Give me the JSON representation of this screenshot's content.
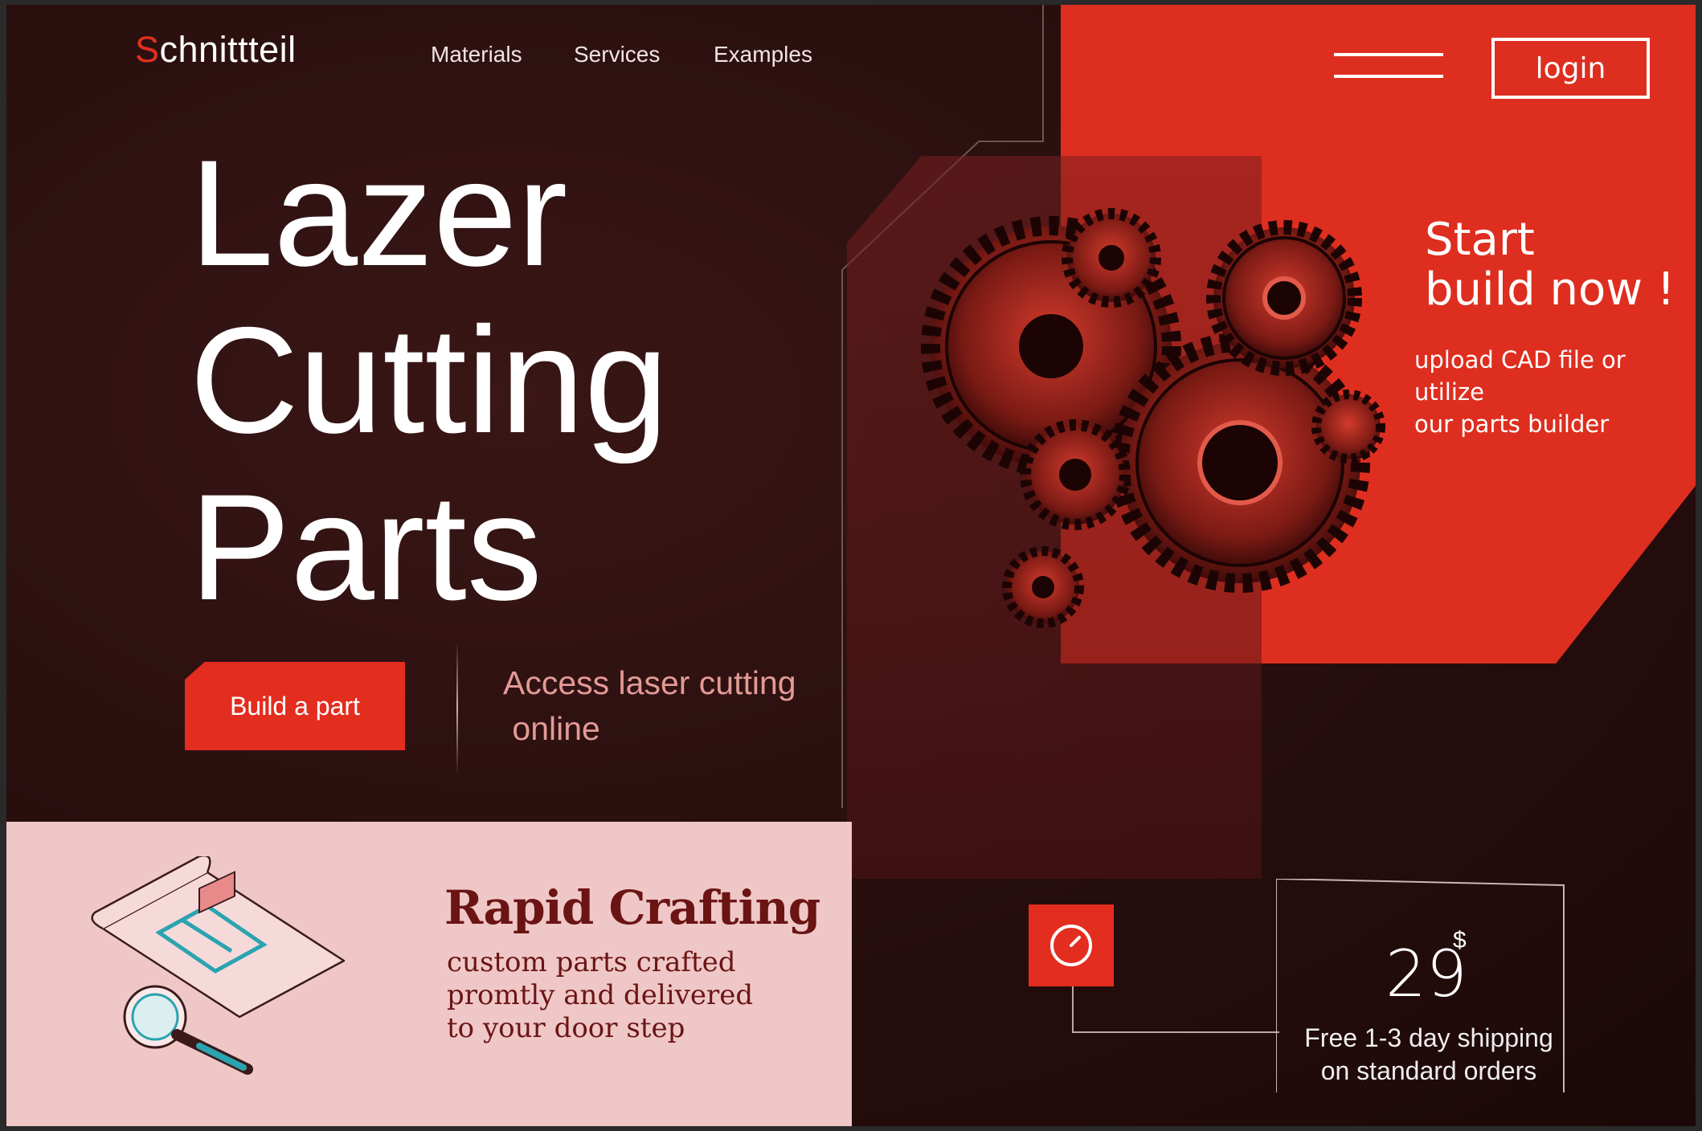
{
  "brand": {
    "first_letter": "S",
    "rest": "chnittteil"
  },
  "nav": {
    "items": [
      "Materials",
      "Services",
      "Examples"
    ]
  },
  "header": {
    "login_label": "login"
  },
  "hero": {
    "title_lines": [
      "Lazer",
      "Cutting",
      "Parts"
    ],
    "cta_label": "Build a part",
    "access_text": "Access laser cutting\n online"
  },
  "promo": {
    "title_line1": "Start",
    "title_line2": "build now !",
    "subtitle_line1": "upload CAD file or utilize",
    "subtitle_line2": "our parts builder"
  },
  "feature": {
    "title": "Rapid Crafting",
    "lines": [
      "custom parts crafted",
      "promtly and delivered",
      "to your door step"
    ]
  },
  "pricing": {
    "price": "29",
    "currency": "$",
    "shipping_line1": "Free 1-3 day shipping",
    "shipping_line2": "on standard orders"
  },
  "colors": {
    "accent": "#e32d1f",
    "dark": "#2a0f0f",
    "pink": "#efc7c7",
    "maroon": "#6b1414"
  },
  "icons": {
    "menu": "hamburger-icon",
    "clock": "clock-icon",
    "illustration": "blueprint-magnifier-illustration",
    "gears": "gears-image"
  }
}
